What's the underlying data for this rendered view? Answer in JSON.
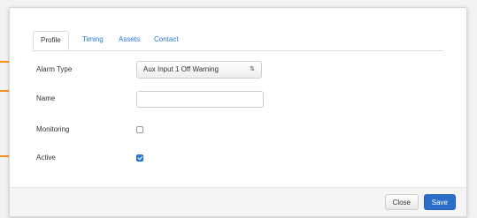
{
  "tabs": [
    {
      "label": "Profile",
      "active": true
    },
    {
      "label": "Timing",
      "active": false
    },
    {
      "label": "Assets",
      "active": false
    },
    {
      "label": "Contact",
      "active": false
    }
  ],
  "form": {
    "alarm_type": {
      "label": "Alarm Type",
      "value": "Aux Input 1 Off Warning"
    },
    "name": {
      "label": "Name",
      "value": "",
      "placeholder": ""
    },
    "monitoring": {
      "label": "Monitoring",
      "checked": false
    },
    "active": {
      "label": "Active",
      "checked": true
    }
  },
  "footer": {
    "close_label": "Close",
    "save_label": "Save"
  },
  "colors": {
    "accent": "#2c6fcb",
    "link": "#2a7ad8",
    "annotation_arrow": "#f7941d"
  },
  "icons": {
    "select_arrows": "updown-arrows-icon",
    "annotation": "arrow-right-icon"
  }
}
